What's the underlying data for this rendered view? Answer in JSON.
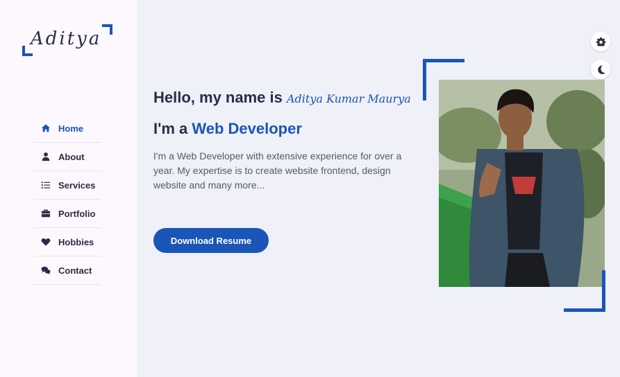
{
  "logo": {
    "text": "Aditya"
  },
  "nav": {
    "items": [
      {
        "label": "Home",
        "icon": "home-icon"
      },
      {
        "label": "About",
        "icon": "user-icon"
      },
      {
        "label": "Services",
        "icon": "list-icon"
      },
      {
        "label": "Portfolio",
        "icon": "briefcase-icon"
      },
      {
        "label": "Hobbies",
        "icon": "heart-icon"
      },
      {
        "label": "Contact",
        "icon": "chat-icon"
      }
    ],
    "active": "Home"
  },
  "hero": {
    "greeting_prefix": "Hello, my name is ",
    "name": "Aditya Kumar Maurya",
    "role_prefix": "I'm a ",
    "role": "Web Developer",
    "description": "I'm a Web Developer with extensive experience for over a year. My expertise is to create website frontend, design website and many more...",
    "button_label": "Download Resume"
  },
  "controls": {
    "settings_icon": "gear-icon",
    "theme_icon": "moon-icon"
  },
  "colors": {
    "accent": "#1a55b8",
    "sidebar_bg": "#fcf8fd",
    "page_bg": "#eff0f8",
    "text": "#2a2c45"
  }
}
